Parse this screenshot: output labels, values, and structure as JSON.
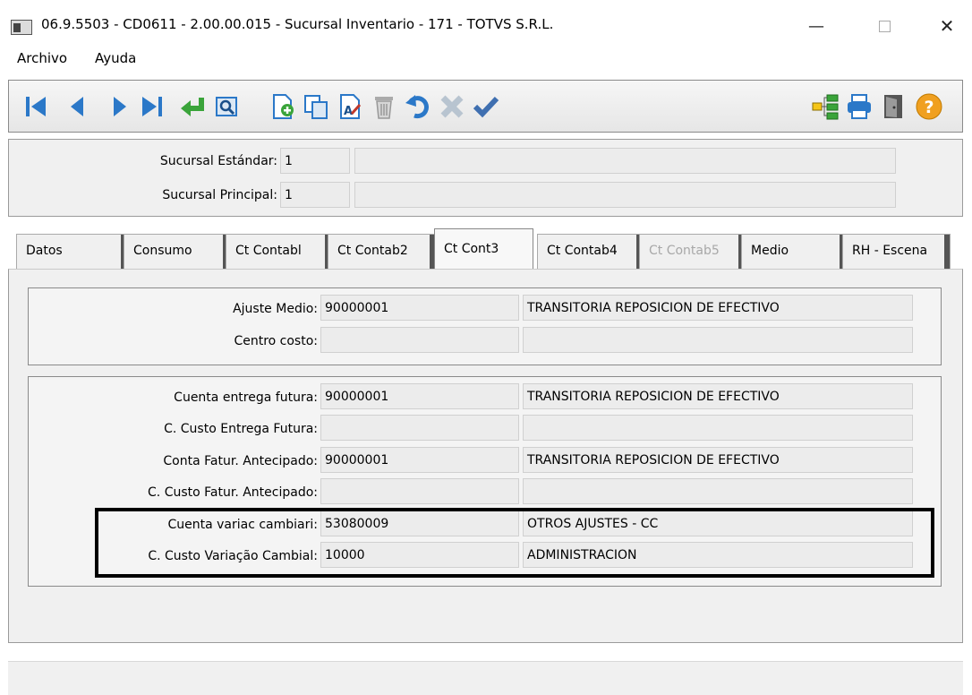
{
  "window": {
    "title": "06.9.5503 - CD0611 - 2.00.00.015 - Sucursal Inventario - 171 - TOTVS S.R.L.",
    "minimize": "—",
    "close": "✕"
  },
  "menu": {
    "archivo": "Archivo",
    "ayuda": "Ayuda"
  },
  "toolbar": {
    "icons": [
      "first-record-icon",
      "previous-record-icon",
      "next-record-icon",
      "last-record-icon",
      "goto-icon",
      "query-icon",
      "new-record-icon",
      "copy-record-icon",
      "edit-record-icon",
      "delete-record-icon",
      "undo-icon",
      "cancel-icon",
      "save-icon",
      "zoom-tree-icon",
      "print-icon",
      "exit-icon",
      "help-icon"
    ]
  },
  "header": {
    "sucursal_estandar_label": "Sucursal Estándar:",
    "sucursal_estandar_value": "1",
    "sucursal_estandar_desc": "",
    "sucursal_principal_label": "Sucursal Principal:",
    "sucursal_principal_value": "1",
    "sucursal_principal_desc": ""
  },
  "tabs": [
    {
      "label": "Datos",
      "state": "normal"
    },
    {
      "label": "Consumo",
      "state": "normal"
    },
    {
      "label": "Ct Contabl",
      "state": "normal"
    },
    {
      "label": "Ct Contab2",
      "state": "normal"
    },
    {
      "label": "Ct Cont3",
      "state": "active"
    },
    {
      "label": "Ct Contab4",
      "state": "normal"
    },
    {
      "label": "Ct Contab5",
      "state": "disabled"
    },
    {
      "label": "Medio",
      "state": "normal"
    },
    {
      "label": "RH - Escena",
      "state": "normal"
    }
  ],
  "group1": {
    "ajuste_medio_label": "Ajuste Medio:",
    "ajuste_medio_value": "90000001",
    "ajuste_medio_desc": "TRANSITORIA REPOSICION DE EFECTIVO",
    "centro_costo_label": "Centro costo:",
    "centro_costo_value": "",
    "centro_costo_desc": ""
  },
  "group2": {
    "cuenta_entrega_label": "Cuenta entrega futura:",
    "cuenta_entrega_value": "90000001",
    "cuenta_entrega_desc": "TRANSITORIA REPOSICION DE EFECTIVO",
    "ccusto_entrega_label": "C. Custo Entrega Futura:",
    "ccusto_entrega_value": "",
    "ccusto_entrega_desc": "",
    "conta_fatur_label": "Conta Fatur. Antecipado:",
    "conta_fatur_value": "90000001",
    "conta_fatur_desc": "TRANSITORIA REPOSICION DE EFECTIVO",
    "ccusto_fatur_label": "C. Custo Fatur. Antecipado:",
    "ccusto_fatur_value": "",
    "ccusto_fatur_desc": "",
    "cuenta_variac_label": "Cuenta variac cambiari:",
    "cuenta_variac_value": "53080009",
    "cuenta_variac_desc": "OTROS AJUSTES - CC",
    "ccusto_variacao_label": "C. Custo Variação Cambial:",
    "ccusto_variacao_value": "10000",
    "ccusto_variacao_desc": "ADMINISTRACION"
  },
  "colors": {
    "toolbar_blue": "#2b78c8",
    "toolbar_green": "#3aa43a",
    "help_orange": "#f0a020",
    "highlight_border": "#000000"
  }
}
